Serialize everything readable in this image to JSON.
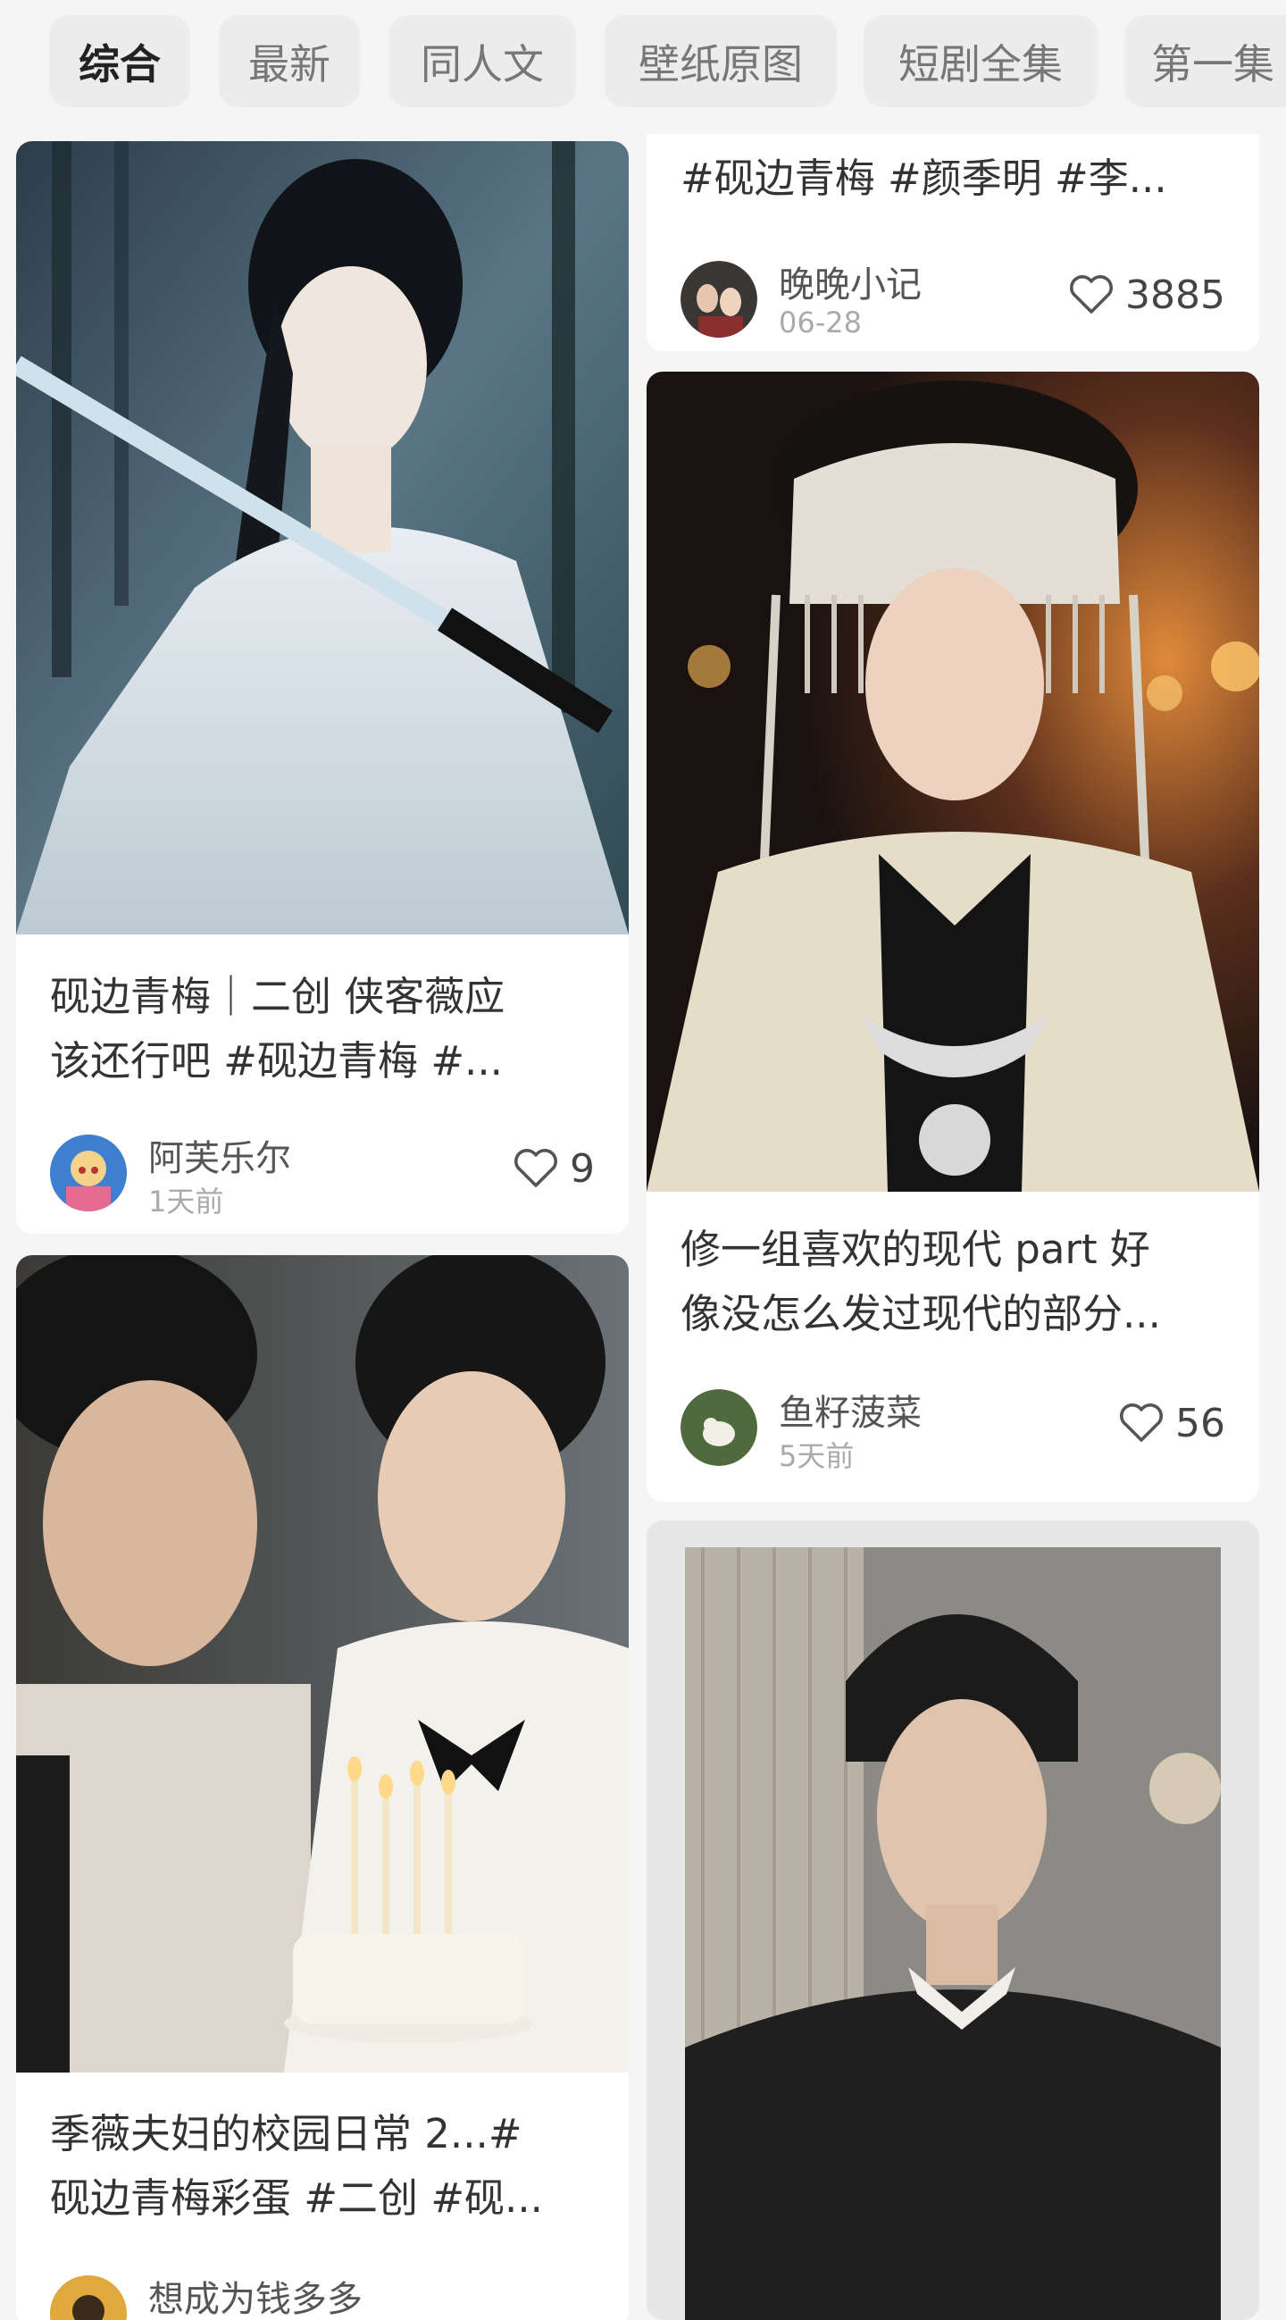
{
  "tabs": [
    {
      "label": "综合",
      "active": true
    },
    {
      "label": "最新",
      "active": false
    },
    {
      "label": "同人文",
      "active": false
    },
    {
      "label": "壁纸原图",
      "active": false
    },
    {
      "label": "短剧全集",
      "active": false
    },
    {
      "label": "第一集",
      "active": false
    }
  ],
  "feed": {
    "left": [
      {
        "title_line1": "砚边青梅｜二创 侠客薇应",
        "title_line2": "该还行吧 #砚边青梅 #...",
        "author": "阿芙乐尔",
        "time": "1天前",
        "likes": "9",
        "image_icon": "swordswoman-photo"
      },
      {
        "title_line1": "季薇夫妇的校园日常 2...#",
        "title_line2": "砚边青梅彩蛋 #二创 #砚...",
        "author": "想成为钱多多",
        "image_icon": "birthday-couple-photo"
      }
    ],
    "right": [
      {
        "title_line1": "#砚边青梅 #颜季明 #李...",
        "author": "晚晚小记",
        "time": "06-28",
        "likes": "3885"
      },
      {
        "title_line1": "修一组喜欢的现代 part 好",
        "title_line2": "像没怎么发过现代的部分...",
        "author": "鱼籽菠菜",
        "time": "5天前",
        "likes": "56",
        "image_icon": "miao-headdress-photo"
      },
      {
        "image_icon": "scholar-man-photo"
      }
    ]
  },
  "colors": {
    "background": "#f5f5f5",
    "card": "#ffffff",
    "tab_bg": "#ececec"
  }
}
